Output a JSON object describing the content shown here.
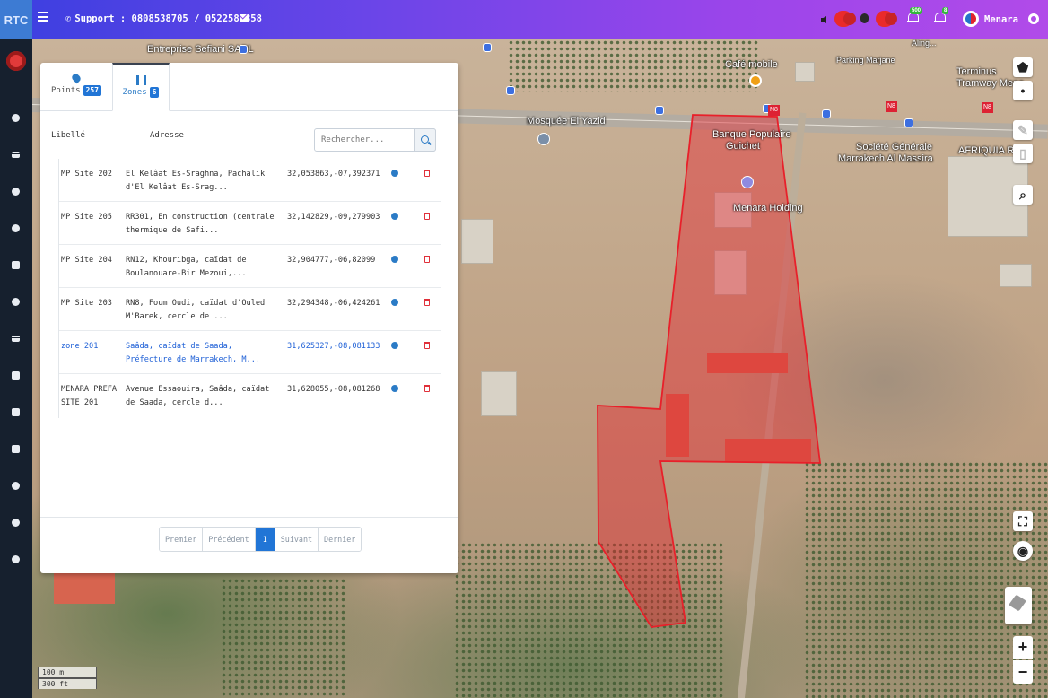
{
  "app": {
    "brand": "RTC",
    "support_label": "Support : 0808538705 / 0522583358",
    "user": "Menara"
  },
  "notifications": {
    "alerts_count": "500",
    "events_count": "8"
  },
  "tabs": [
    {
      "label": "Points",
      "count": "257",
      "active": false
    },
    {
      "label": "Zones",
      "count": "6",
      "active": true
    }
  ],
  "table": {
    "headers": {
      "libelle": "Libellé",
      "adresse": "Adresse"
    },
    "search_placeholder": "Rechercher...",
    "rows": [
      {
        "libelle": "MP Site 202",
        "adresse": "El Kelâat Es-Sraghna, Pachalik d'El Kelâat Es-Srag...",
        "coords": "32,053863,-07,392371",
        "selected": false
      },
      {
        "libelle": "MP Site 205",
        "adresse": "RR301, En construction (centrale thermique de Safi...",
        "coords": "32,142829,-09,279903",
        "selected": false
      },
      {
        "libelle": "MP Site 204",
        "adresse": "RN12, Khouribga, caïdat de Boulanouare-Bir Mezoui,...",
        "coords": "32,904777,-06,82099",
        "selected": false
      },
      {
        "libelle": "MP Site 203",
        "adresse": "RN8, Foum Oudi, caïdat d'Ouled M'Barek, cercle de ...",
        "coords": "32,294348,-06,424261",
        "selected": false
      },
      {
        "libelle": "zone 201",
        "adresse": "Saâda, caïdat de Saada, Préfecture de Marrakech, M...",
        "coords": "31,625327,-08,081133",
        "selected": true
      },
      {
        "libelle": "MENARA PREFA SITE 201",
        "adresse": "Avenue Essaouira, Saâda, caïdat de Saada, cercle d...",
        "coords": "31,628055,-08,081268",
        "selected": false
      }
    ]
  },
  "pagination": {
    "first": "Premier",
    "prev": "Précédent",
    "current": "1",
    "next": "Suivant",
    "last": "Dernier"
  },
  "map": {
    "labels": {
      "entreprise": "Entreprise Sefiani SARL",
      "cafe": "Café mobile",
      "parking": "Parking Marjane",
      "terminus_1": "Terminus",
      "terminus_2": "Tramway Mena",
      "mosquee": "Mosquée El Yazid",
      "banque_1": "Banque Populaire",
      "banque_2": "Guichet",
      "societe_1": "Société Générale",
      "societe_2": "Marrakech Al Massira",
      "afriquia": "AFRIQUIA RAK",
      "menara_holding": "Menara Holding",
      "n8_a": "N8",
      "n8_b": "N8",
      "n8_c": "N8",
      "top_right": "Aling..."
    },
    "scale": {
      "metric": "100 m",
      "imperial": "300 ft"
    },
    "zoom_in": "+",
    "zoom_out": "−",
    "zone_color": "#e8202a"
  }
}
